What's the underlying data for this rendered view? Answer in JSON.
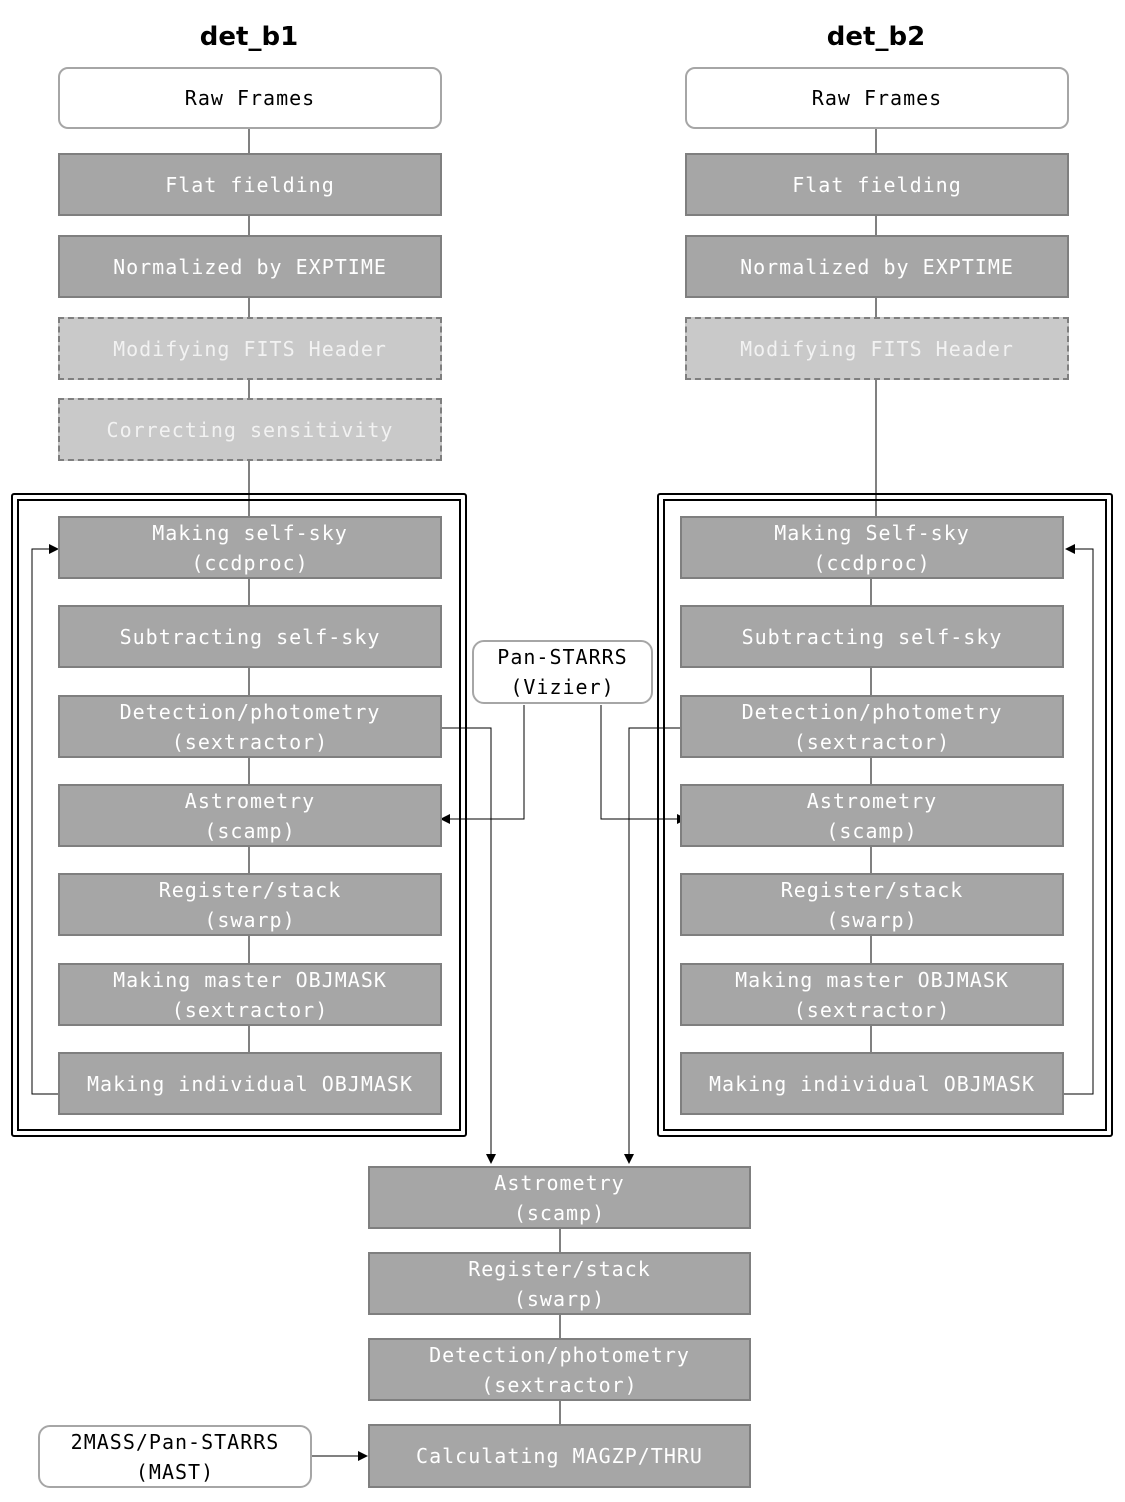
{
  "diagram": {
    "columns": [
      {
        "title": "det_b1",
        "raw": "Raw Frames",
        "pre_steps": [
          "Flat fielding",
          "Normalized by EXPTIME"
        ],
        "optional_steps": [
          "Modifying FITS Header",
          "Correcting sensitivity"
        ],
        "loop_steps": [
          "Making self-sky\n(ccdproc)",
          "Subtracting self-sky",
          "Detection/photometry\n(sextractor)",
          "Astrometry\n(scamp)",
          "Register/stack\n(swarp)",
          "Making master OBJMASK\n(sextractor)",
          "Making individual OBJMASK"
        ]
      },
      {
        "title": "det_b2",
        "raw": "Raw Frames",
        "pre_steps": [
          "Flat fielding",
          "Normalized by EXPTIME"
        ],
        "optional_steps": [
          "Modifying FITS Header"
        ],
        "loop_steps": [
          "Making Self-sky\n(ccdproc)",
          "Subtracting self-sky",
          "Detection/photometry\n(sextractor)",
          "Astrometry\n(scamp)",
          "Register/stack\n(swarp)",
          "Making master OBJMASK\n(sextractor)",
          "Making individual OBJMASK"
        ]
      }
    ],
    "external_catalogs": {
      "panstarrs": "Pan-STARRS\n(Vizier)",
      "mast": "2MASS/Pan-STARRS\n(MAST)"
    },
    "combined_steps": [
      "Astrometry\n(scamp)",
      "Register/stack\n(swarp)",
      "Detection/photometry\n(sextractor)",
      "Calculating MAGZP/THRU"
    ],
    "colors": {
      "step_fill": "#a6a6a6",
      "step_border": "#7f7f7f",
      "optional_fill": "#c9c9c9",
      "raw_border": "#a6a6a6"
    }
  }
}
